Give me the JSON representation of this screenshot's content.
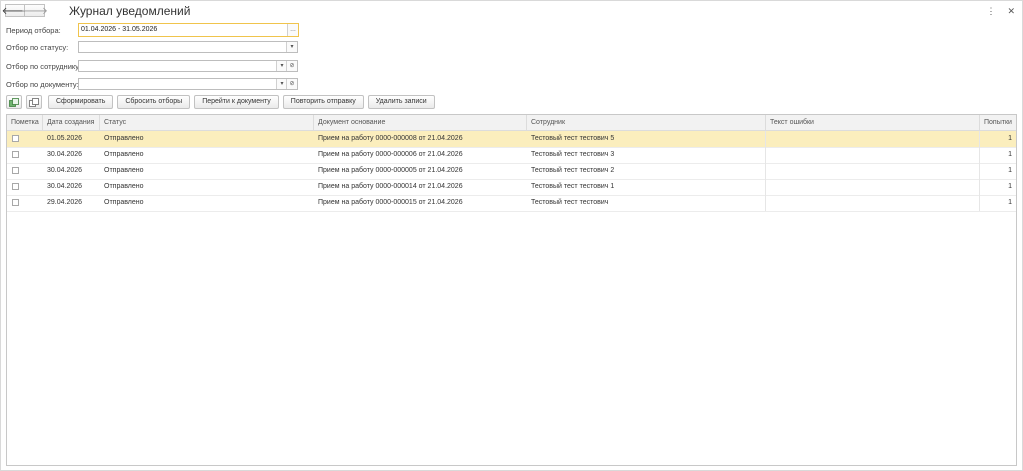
{
  "nav": {
    "back_icon": "arrow-left-icon",
    "forward_icon": "arrow-right-icon"
  },
  "title": "Журнал уведомлений",
  "filters": {
    "period_label": "Период отбора:",
    "period_value": "01.04.2026 - 31.05.2026",
    "status_label": "Отбор по статусу:",
    "status_value": "",
    "employee_label": "Отбор по сотруднику:",
    "employee_value": "",
    "document_label": "Отбор по документу:",
    "document_value": ""
  },
  "toolbar": {
    "form": "Сформировать",
    "reset": "Сбросить отборы",
    "goto": "Перейти к документу",
    "retry": "Повторить отправку",
    "delete": "Удалить записи"
  },
  "table": {
    "columns": [
      "Пометка",
      "Дата создания",
      "Статус",
      "Документ основание",
      "Сотрудник",
      "Текст ошибки",
      "Попытки"
    ],
    "rows": [
      {
        "date": "01.05.2026",
        "status": "Отправлено",
        "doc": "Прием на работу 0000-000008 от 21.04.2026",
        "employee": "Тестовый тест тестович 5",
        "error": "",
        "attempts": "1"
      },
      {
        "date": "30.04.2026",
        "status": "Отправлено",
        "doc": "Прием на работу 0000-000006 от 21.04.2026",
        "employee": "Тестовый тест тестович 3",
        "error": "",
        "attempts": "1"
      },
      {
        "date": "30.04.2026",
        "status": "Отправлено",
        "doc": "Прием на работу 0000-000005 от 21.04.2026",
        "employee": "Тестовый тест тестович 2",
        "error": "",
        "attempts": "1"
      },
      {
        "date": "30.04.2026",
        "status": "Отправлено",
        "doc": "Прием на работу 0000-000014 от 21.04.2026",
        "employee": "Тестовый тест тестович 1",
        "error": "",
        "attempts": "1"
      },
      {
        "date": "29.04.2026",
        "status": "Отправлено",
        "doc": "Прием на работу 0000-000015 от 21.04.2026",
        "employee": "Тестовый тест тестович",
        "error": "",
        "attempts": "1"
      }
    ]
  }
}
